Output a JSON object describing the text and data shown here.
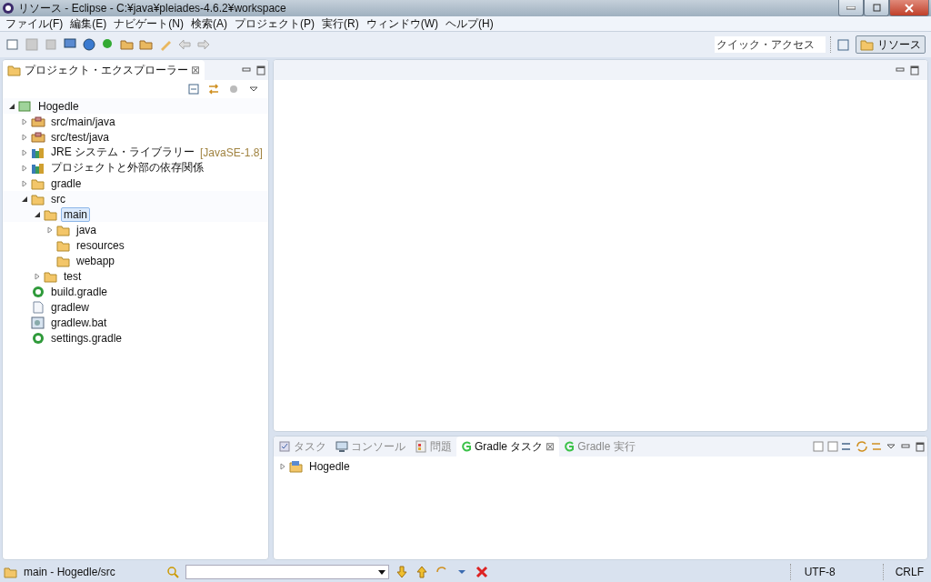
{
  "window": {
    "title": "リソース - Eclipse - C:¥java¥pleiades-4.6.2¥workspace"
  },
  "menu": [
    "ファイル(F)",
    "編集(E)",
    "ナビゲート(N)",
    "検索(A)",
    "プロジェクト(P)",
    "実行(R)",
    "ウィンドウ(W)",
    "ヘルプ(H)"
  ],
  "quick_access": {
    "placeholder": "クイック・アクセス"
  },
  "perspective": {
    "label": "リソース",
    "selected": true
  },
  "explorer": {
    "title": "プロジェクト・エクスプローラー",
    "close": "⊠",
    "tree": [
      {
        "label": "Hogedle",
        "kind": "project",
        "expandable": true,
        "expanded": true,
        "selected": false,
        "children": [
          {
            "label": "src/main/java",
            "kind": "package",
            "expandable": true,
            "expanded": false,
            "selected": false
          },
          {
            "label": "src/test/java",
            "kind": "package",
            "expandable": true,
            "expanded": false,
            "selected": false
          },
          {
            "label": "JRE システム・ライブラリー",
            "suffix": "[JavaSE-1.8]",
            "kind": "library",
            "expandable": true,
            "expanded": false,
            "selected": false
          },
          {
            "label": "プロジェクトと外部の依存関係",
            "kind": "library",
            "expandable": true,
            "expanded": false,
            "selected": false
          },
          {
            "label": "gradle",
            "kind": "folder",
            "expandable": true,
            "expanded": false,
            "selected": false
          },
          {
            "label": "src",
            "kind": "folder",
            "expandable": true,
            "expanded": true,
            "selected": false,
            "children": [
              {
                "label": "main",
                "kind": "folder",
                "expandable": true,
                "expanded": true,
                "selected": true,
                "children": [
                  {
                    "label": "java",
                    "kind": "folder",
                    "expandable": true,
                    "expanded": false,
                    "selected": false
                  },
                  {
                    "label": "resources",
                    "kind": "folder",
                    "expandable": false,
                    "selected": false
                  },
                  {
                    "label": "webapp",
                    "kind": "folder",
                    "expandable": false,
                    "selected": false
                  }
                ]
              },
              {
                "label": "test",
                "kind": "folder",
                "expandable": true,
                "expanded": false,
                "selected": false
              }
            ]
          },
          {
            "label": "build.gradle",
            "kind": "gradle",
            "expandable": false,
            "selected": false
          },
          {
            "label": "gradlew",
            "kind": "file",
            "expandable": false,
            "selected": false
          },
          {
            "label": "gradlew.bat",
            "kind": "bat",
            "expandable": false,
            "selected": false
          },
          {
            "label": "settings.gradle",
            "kind": "gradle",
            "expandable": false,
            "selected": false
          }
        ]
      }
    ]
  },
  "bottom": {
    "tabs": [
      {
        "label": "タスク",
        "kind": "task",
        "selected": false
      },
      {
        "label": "コンソール",
        "kind": "console",
        "selected": false
      },
      {
        "label": "問題",
        "kind": "problems",
        "selected": false
      },
      {
        "label": "Gradle タスク",
        "kind": "gradle",
        "selected": true,
        "close": "⊠"
      },
      {
        "label": "Gradle 実行",
        "kind": "gradle",
        "selected": false
      }
    ],
    "tree": [
      {
        "label": "Hogedle",
        "kind": "project-folder",
        "expandable": true,
        "expanded": false,
        "selected": false
      }
    ]
  },
  "status_bar": {
    "selection": "main - Hogedle/src",
    "encoding": "UTF-8",
    "line_ending": "CRLF"
  }
}
